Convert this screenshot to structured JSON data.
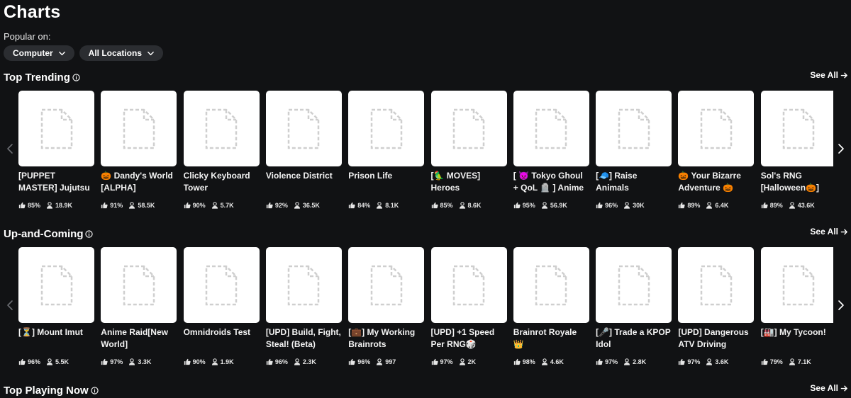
{
  "page": {
    "title": "Charts",
    "popular_label": "Popular on:"
  },
  "filters": {
    "device": "Computer",
    "location": "All Locations"
  },
  "see_all_label": "See All",
  "sections": [
    {
      "title": "Top Trending",
      "cards": [
        {
          "title": "[PUPPET MASTER] Jujutsu",
          "rating": "85%",
          "players": "18.9K"
        },
        {
          "title": "🎃 Dandy's World [ALPHA]",
          "rating": "91%",
          "players": "58.5K"
        },
        {
          "title": "Clicky Keyboard Tower",
          "rating": "90%",
          "players": "5.7K"
        },
        {
          "title": "Violence District",
          "rating": "92%",
          "players": "36.5K"
        },
        {
          "title": "Prison Life",
          "rating": "84%",
          "players": "8.1K"
        },
        {
          "title": "[🦜 MOVES] Heroes",
          "rating": "85%",
          "players": "8.6K"
        },
        {
          "title": "[ 👿 Tokyo Ghoul + QoL 🪦 ] Anime",
          "rating": "95%",
          "players": "56.9K"
        },
        {
          "title": "[🧢] Raise Animals",
          "rating": "96%",
          "players": "30K"
        },
        {
          "title": "🎃 Your Bizarre Adventure 🎃",
          "rating": "89%",
          "players": "6.4K"
        },
        {
          "title": "Sol's RNG [Halloween🎃]",
          "rating": "89%",
          "players": "43.6K"
        }
      ]
    },
    {
      "title": "Up-and-Coming",
      "cards": [
        {
          "title": "[⏳] Mount Imut",
          "rating": "96%",
          "players": "5.5K"
        },
        {
          "title": "Anime Raid[New World]",
          "rating": "97%",
          "players": "3.3K"
        },
        {
          "title": "Omnidroids Test",
          "rating": "90%",
          "players": "1.9K"
        },
        {
          "title": "[UPD] Build, Fight, Steal! (Beta)",
          "rating": "96%",
          "players": "2.3K"
        },
        {
          "title": "[💼] My Working Brainrots",
          "rating": "96%",
          "players": "997"
        },
        {
          "title": "[UPD] +1 Speed Per RNG🎲",
          "rating": "97%",
          "players": "2K"
        },
        {
          "title": "Brainrot Royale 👑",
          "rating": "98%",
          "players": "4.6K"
        },
        {
          "title": "[🎤] Trade a KPOP Idol",
          "rating": "97%",
          "players": "2.8K"
        },
        {
          "title": "[UPD] Dangerous ATV Driving",
          "rating": "97%",
          "players": "3.6K"
        },
        {
          "title": "[🏭] My Tycoon!",
          "rating": "79%",
          "players": "7.1K"
        }
      ]
    },
    {
      "title": "Top Playing Now",
      "cards": []
    }
  ]
}
